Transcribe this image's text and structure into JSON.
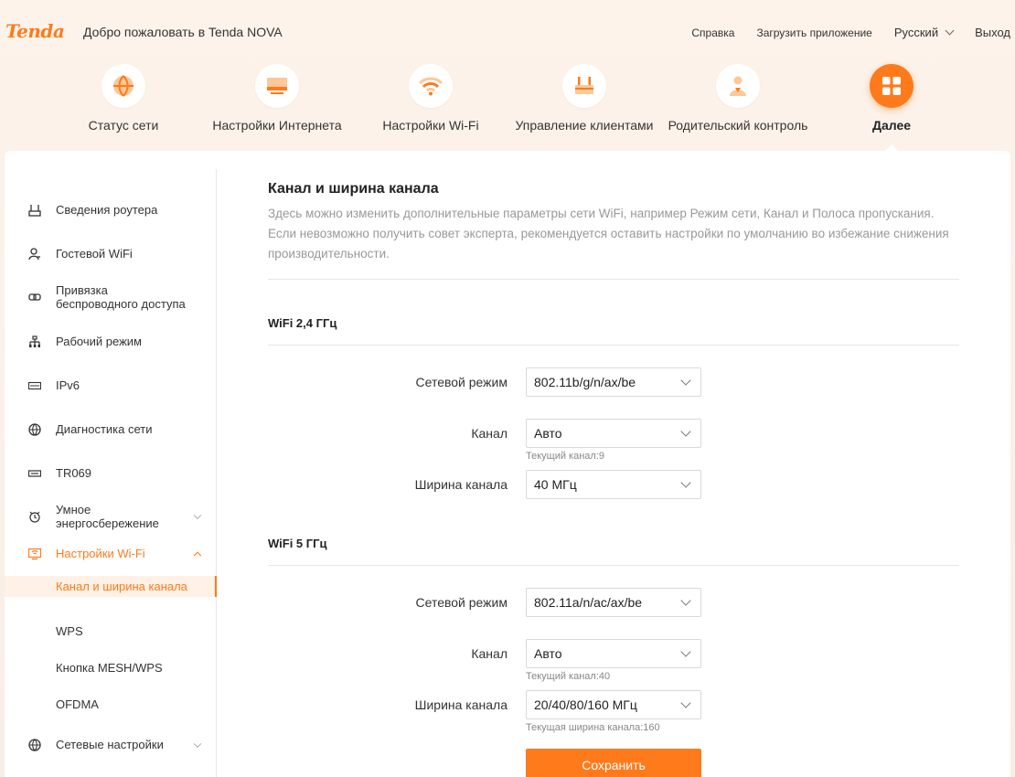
{
  "header": {
    "logo": "Tenda",
    "welcome": "Добро пожаловать в Tenda NOVA",
    "help": "Справка",
    "download_app": "Загрузить приложение",
    "language": "Русский",
    "logout": "Выход"
  },
  "nav": [
    {
      "label": "Статус сети",
      "icon": "globe-icon"
    },
    {
      "label": "Настройки Интернета",
      "icon": "internet-icon"
    },
    {
      "label": "Настройки Wi-Fi",
      "icon": "wifi-icon"
    },
    {
      "label": "Управление клиентами",
      "icon": "router-icon"
    },
    {
      "label": "Родительский контроль",
      "icon": "parent-icon"
    },
    {
      "label": "Далее",
      "icon": "grid-icon",
      "active": true
    }
  ],
  "sidebar": {
    "items": [
      {
        "label": "Сведения роутера",
        "icon": "router-small-icon"
      },
      {
        "label": "Гостевой WiFi",
        "icon": "guest-icon"
      },
      {
        "label": "Привязка беспроводного доступа",
        "icon": "link-icon"
      },
      {
        "label": "Рабочий режим",
        "icon": "hierarchy-icon"
      },
      {
        "label": "IPv6",
        "icon": "ipv6-icon"
      },
      {
        "label": "Диагностика сети",
        "icon": "globe-small-icon"
      },
      {
        "label": "TR069",
        "icon": "tr069-icon"
      },
      {
        "label": "Умное энергосбережение",
        "icon": "alarm-icon"
      },
      {
        "label": "Настройки Wi-Fi",
        "icon": "wifi-settings-icon"
      },
      {
        "label": "Сетевые настройки",
        "icon": "globe-small-icon"
      }
    ],
    "sub": [
      {
        "label": "Канал и ширина канала"
      },
      {
        "label": "WPS"
      },
      {
        "label": "Кнопка MESH/WPS"
      },
      {
        "label": "OFDMA"
      }
    ]
  },
  "content": {
    "title": "Канал и ширина канала",
    "description": "Здесь можно изменить дополнительные параметры сети WiFi, например Режим сети, Канал и Полоса пропускания. Если невозможно получить совет эксперта, рекомендуется оставить настройки по умолчанию во избежание снижения производительности.",
    "band24": {
      "title": "WiFi 2,4 ГГц",
      "mode_label": "Сетевой режим",
      "mode_value": "802.11b/g/n/ax/be",
      "channel_label": "Канал",
      "channel_value": "Авто",
      "channel_hint": "Текущий канал:9",
      "width_label": "Ширина канала",
      "width_value": "40 МГц"
    },
    "band5": {
      "title": "WiFi 5 ГГц",
      "mode_label": "Сетевой режим",
      "mode_value": "802.11a/n/ac/ax/be",
      "channel_label": "Канал",
      "channel_value": "Авто",
      "channel_hint": "Текущий канал:40",
      "width_label": "Ширина канала",
      "width_value": "20/40/80/160 МГц",
      "width_hint": "Текущая ширина канала:160"
    },
    "save": "Сохранить"
  },
  "colors": {
    "accent": "#ff7a1a",
    "nav_icon_light": "#fbc89a"
  }
}
